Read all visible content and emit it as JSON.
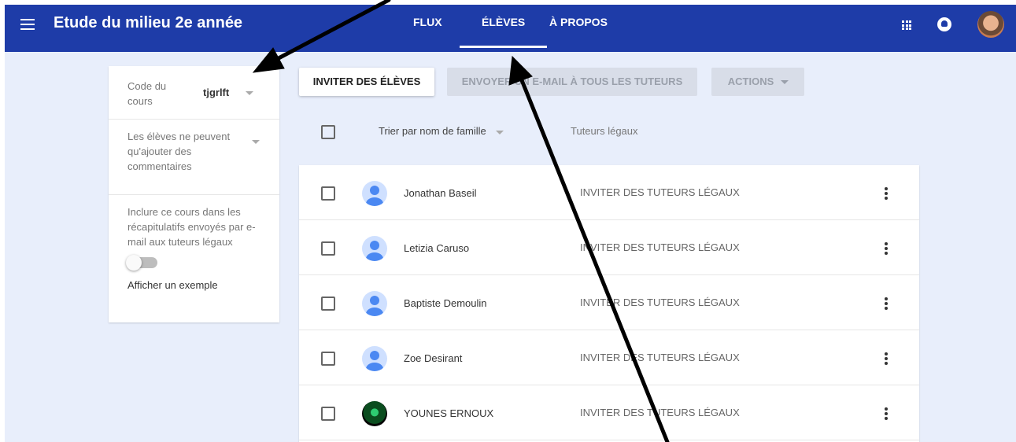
{
  "header": {
    "title": "Etude du milieu 2e année",
    "tabs": [
      {
        "label": "FLUX",
        "active": false
      },
      {
        "label": "ÉLÈVES",
        "active": true
      },
      {
        "label": "À PROPOS",
        "active": false
      }
    ],
    "icons": [
      "menu-icon",
      "apps-icon",
      "notifications-icon",
      "user-avatar"
    ]
  },
  "sidebar": {
    "code_label": "Code du cours",
    "code_value": "tjgrlft",
    "comments_setting": "Les élèves ne peuvent qu'ajouter des commentaires",
    "summary_text": "Inclure ce cours dans les récapitulatifs envoyés par e-mail aux tuteurs légaux",
    "summary_toggle_on": false,
    "example_link": "Afficher un exemple"
  },
  "actions": {
    "invite": "INVITER DES ÉLÈVES",
    "email": "ENVOYER UN E-MAIL À TOUS LES TUTEURS",
    "more": "ACTIONS"
  },
  "list": {
    "sort_label": "Trier par nom de famille",
    "guardians_header": "Tuteurs légaux",
    "students": [
      {
        "name": "Jonathan Baseil",
        "guardian_action": "INVITER DES TUTEURS LÉGAUX",
        "avatar": "default"
      },
      {
        "name": "Letizia Caruso",
        "guardian_action": "INVITER DES TUTEURS LÉGAUX",
        "avatar": "default"
      },
      {
        "name": "Baptiste Demoulin",
        "guardian_action": "INVITER DES TUTEURS LÉGAUX",
        "avatar": "default"
      },
      {
        "name": "Zoe Desirant",
        "guardian_action": "INVITER DES TUTEURS LÉGAUX",
        "avatar": "default"
      },
      {
        "name": "YOUNES ERNOUX",
        "guardian_action": "INVITER DES TUTEURS LÉGAUX",
        "avatar": "photo"
      }
    ]
  },
  "colors": {
    "topbar": "#1e3ca8",
    "background": "#e8eefb",
    "avatar_blue": "#4b88f2",
    "annotation_arrow": "#000000"
  }
}
